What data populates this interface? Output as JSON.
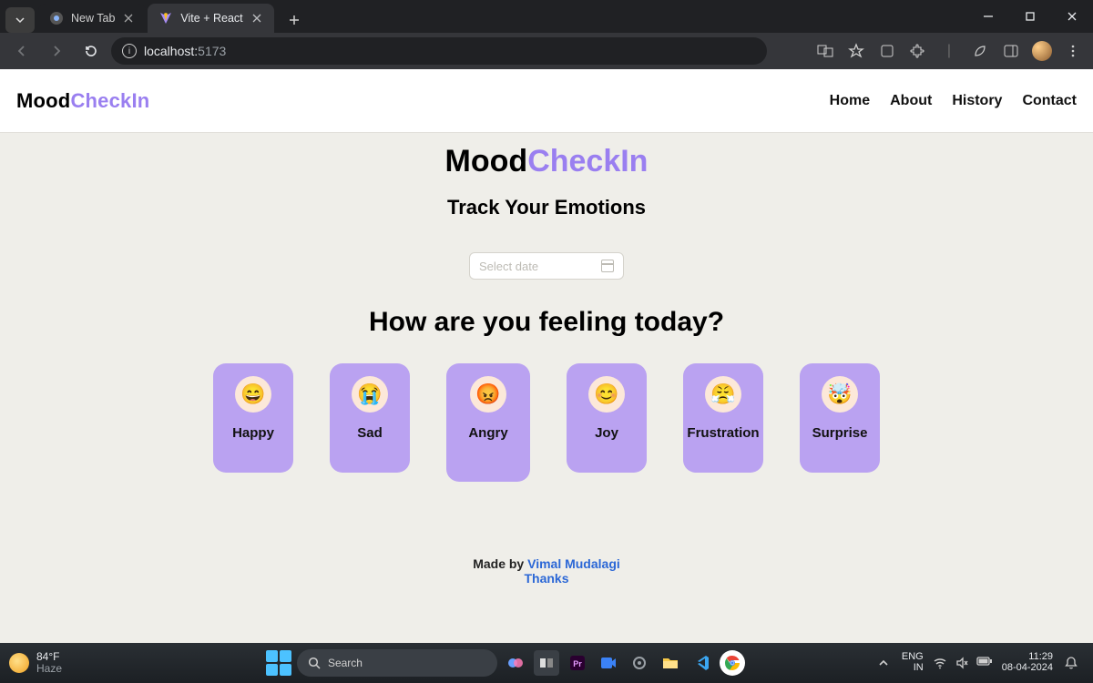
{
  "browser": {
    "tabs": [
      {
        "title": "New Tab",
        "favicon": "chrome"
      },
      {
        "title": "Vite + React",
        "favicon": "vite"
      }
    ],
    "url_host": "localhost:",
    "url_port": "5173"
  },
  "site": {
    "brand_prefix": "Mood",
    "brand_suffix": "CheckIn",
    "nav": [
      "Home",
      "About",
      "History",
      "Contact"
    ]
  },
  "hero": {
    "title_prefix": "Mood",
    "title_suffix": "CheckIn",
    "subtitle": "Track Your Emotions"
  },
  "date": {
    "placeholder": "Select date"
  },
  "question": "How are you feeling today?",
  "moods": [
    {
      "label": "Happy",
      "emoji": "😄"
    },
    {
      "label": "Sad",
      "emoji": "😭"
    },
    {
      "label": "Angry",
      "emoji": "😡",
      "big": true
    },
    {
      "label": "Joy",
      "emoji": "😊"
    },
    {
      "label": "Frustration",
      "emoji": "😤"
    },
    {
      "label": "Surprise",
      "emoji": "🤯"
    }
  ],
  "footer": {
    "made_by_prefix": "Made by ",
    "author": "Vimal Mudalagi",
    "thanks": "Thanks"
  },
  "taskbar": {
    "weather_temp": "84°F",
    "weather_desc": "Haze",
    "search_placeholder": "Search",
    "lang_top": "ENG",
    "lang_bottom": "IN",
    "time": "11:29",
    "date": "08-04-2024"
  }
}
